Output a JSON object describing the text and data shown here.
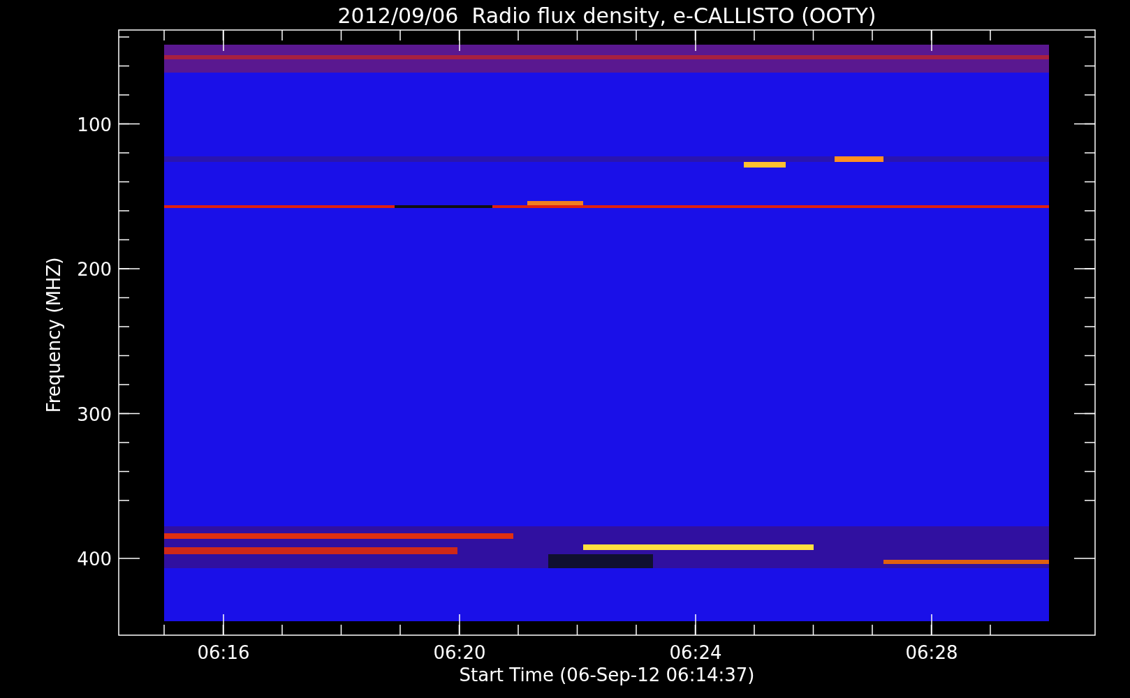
{
  "title": "2012/09/06  Radio flux density, e-CALLISTO (OOTY)",
  "xlabel": "Start Time (06-Sep-12 06:14:37)",
  "ylabel": "Frequency (MHZ)",
  "yticks": [
    "100",
    "200",
    "300",
    "400"
  ],
  "xticks": [
    "06:16",
    "06:20",
    "06:24",
    "06:28"
  ]
}
